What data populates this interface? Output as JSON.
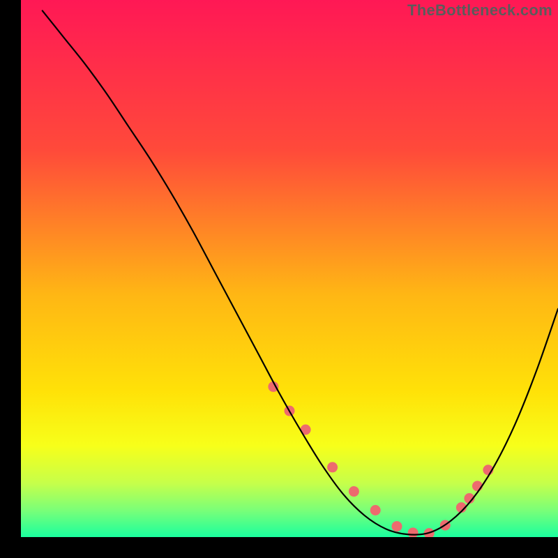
{
  "watermark": "TheBottleneck.com",
  "chart_data": {
    "type": "line",
    "title": "",
    "xlabel": "",
    "ylabel": "",
    "xlim": [
      0,
      100
    ],
    "ylim": [
      0,
      100
    ],
    "gradient_stops": [
      {
        "offset": 0.0,
        "color": "#ff1855"
      },
      {
        "offset": 0.28,
        "color": "#ff4a3a"
      },
      {
        "offset": 0.55,
        "color": "#ffb714"
      },
      {
        "offset": 0.73,
        "color": "#ffe208"
      },
      {
        "offset": 0.83,
        "color": "#f7ff1a"
      },
      {
        "offset": 0.9,
        "color": "#c6ff4a"
      },
      {
        "offset": 0.95,
        "color": "#7aff78"
      },
      {
        "offset": 1.0,
        "color": "#1aff9e"
      }
    ],
    "curve": {
      "x": [
        4,
        8,
        12,
        16,
        20,
        24,
        28,
        32,
        36,
        40,
        44,
        48,
        52,
        56,
        60,
        64,
        68,
        72,
        76,
        80,
        84,
        88,
        92,
        96,
        100
      ],
      "y": [
        98,
        93,
        88,
        82.5,
        76.5,
        70.5,
        64,
        57,
        49.5,
        42,
        34.5,
        27,
        20,
        13.5,
        8,
        4,
        1.5,
        0.5,
        0.8,
        3,
        7,
        13,
        21,
        31,
        42.5
      ]
    },
    "markers": {
      "x": [
        47,
        50,
        53,
        58,
        62,
        66,
        70,
        73,
        76,
        79,
        82,
        83.5,
        85,
        87
      ],
      "y": [
        28,
        23.5,
        20,
        13,
        8.5,
        5,
        2,
        0.8,
        0.7,
        2.2,
        5.5,
        7.2,
        9.5,
        12.5
      ],
      "color": "#ed6a6e",
      "radius": 7.5
    }
  }
}
